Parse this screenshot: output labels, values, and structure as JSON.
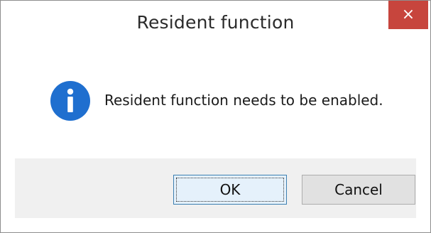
{
  "dialog": {
    "title": "Resident function",
    "close_glyph": "×",
    "message": "Resident function needs to be enabled.",
    "icon": "info-icon",
    "buttons": {
      "ok_label": "OK",
      "cancel_label": "Cancel"
    }
  },
  "colors": {
    "close_button": "#c7453d",
    "info_icon": "#1f6fcf",
    "footer": "#f0f0f0",
    "ok_border": "#3c7fb1"
  }
}
